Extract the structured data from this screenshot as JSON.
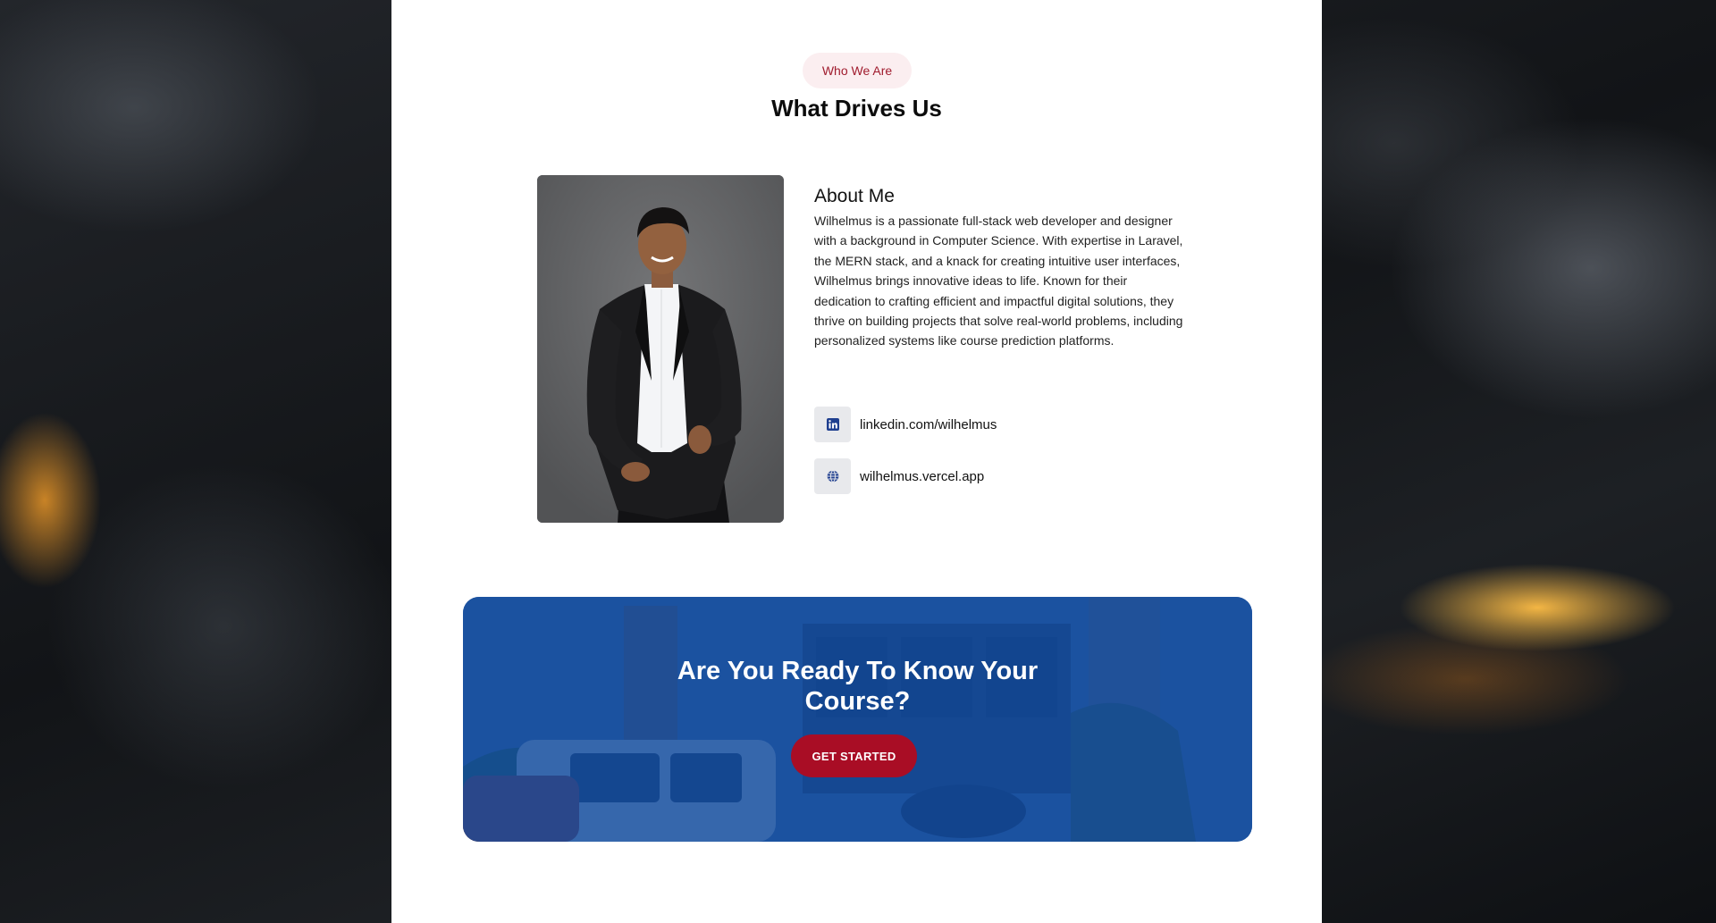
{
  "section": {
    "eyebrow": "Who We Are",
    "title": "What Drives Us"
  },
  "about": {
    "heading": "About Me",
    "body": "Wilhelmus is a passionate full-stack web developer and designer with a background in Computer Science. With expertise in Laravel, the MERN stack, and a knack for creating intuitive user interfaces, Wilhelmus brings innovative ideas to life. Known for their dedication to crafting efficient and impactful digital solutions, they thrive on building projects that solve real-world problems, including personalized systems like course prediction platforms.",
    "photo_icon": "profile-photo"
  },
  "contacts": [
    {
      "icon": "linkedin-icon",
      "text": "linkedin.com/wilhelmus"
    },
    {
      "icon": "globe-icon",
      "text": "wilhelmus.vercel.app"
    }
  ],
  "cta": {
    "title": "Are You Ready To Know Your Course?",
    "button_label": "GET STARTED"
  },
  "colors": {
    "accent_red": "#a90d25",
    "cta_blue": "#0d4a9a",
    "eyebrow_bg": "#fbeef0",
    "icon_blue": "#1f3f8f"
  }
}
